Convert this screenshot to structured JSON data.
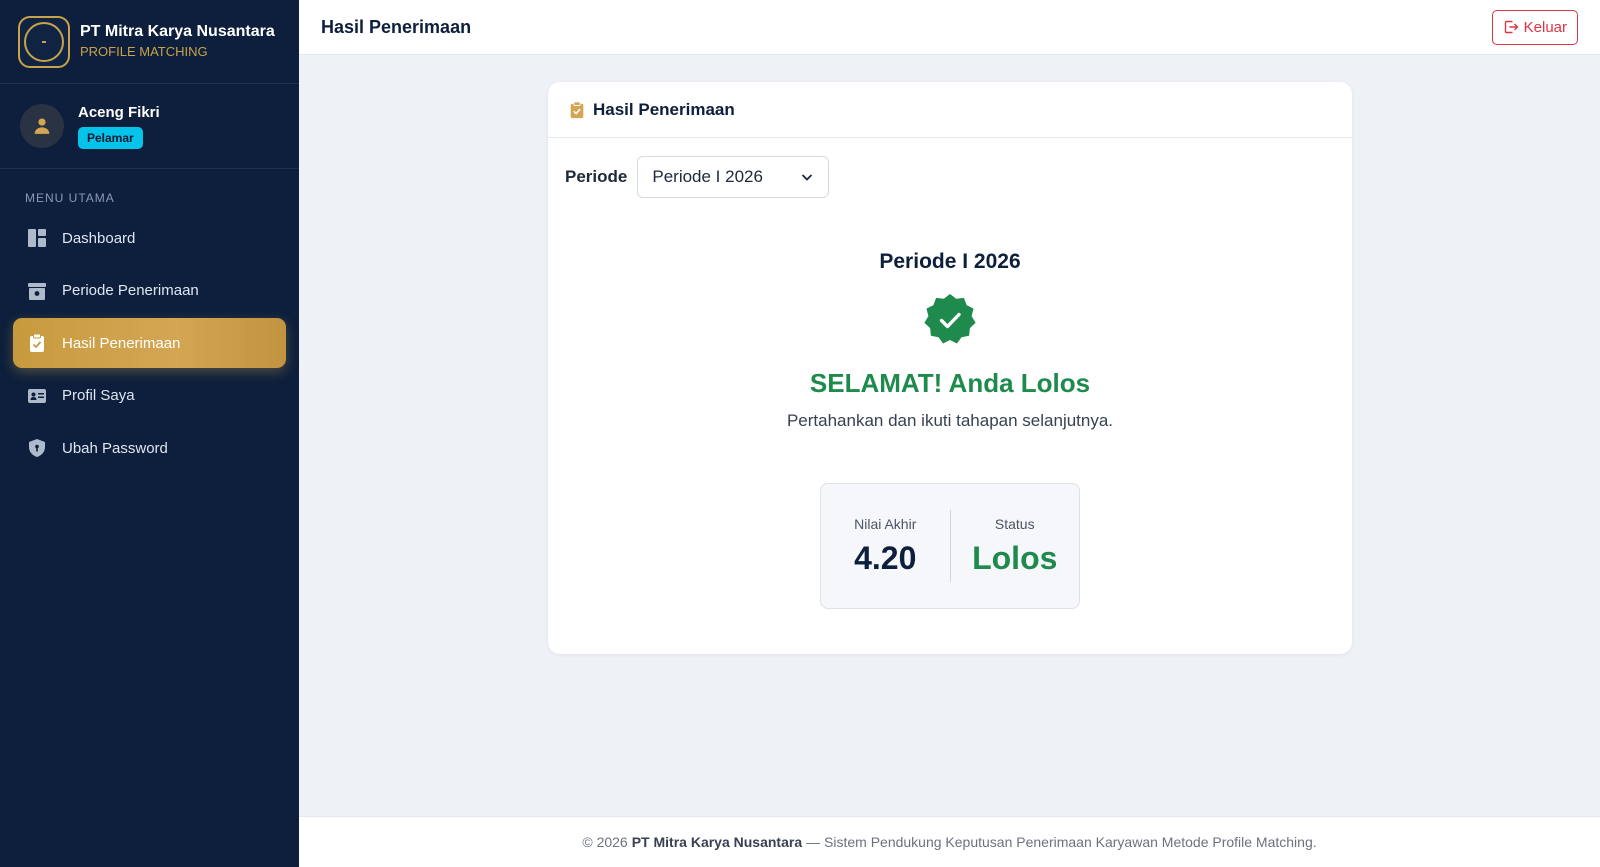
{
  "brand": {
    "name": "PT Mitra Karya Nusantara",
    "subtitle": "PROFILE MATCHING",
    "accent_color": "#c9a24a"
  },
  "user": {
    "name": "Aceng Fikri",
    "role": "Pelamar"
  },
  "sidebar": {
    "section_title": "MENU UTAMA",
    "items": [
      {
        "label": "Dashboard",
        "icon": "dashboard-icon",
        "active": false
      },
      {
        "label": "Periode Penerimaan",
        "icon": "calendar-icon",
        "active": false
      },
      {
        "label": "Hasil Penerimaan",
        "icon": "clipboard-check-icon",
        "active": true
      },
      {
        "label": "Profil Saya",
        "icon": "id-card-icon",
        "active": false
      },
      {
        "label": "Ubah Password",
        "icon": "shield-icon",
        "active": false
      }
    ]
  },
  "header": {
    "title": "Hasil Penerimaan",
    "logout_label": "Keluar"
  },
  "card": {
    "title": "Hasil Penerimaan",
    "period_label": "Periode",
    "period_selected": "Periode I 2026",
    "result": {
      "period": "Periode I 2026",
      "icon": "verified-check-icon",
      "headline": "SELAMAT! Anda Lolos",
      "message": "Pertahankan dan ikuti tahapan selanjutnya.",
      "final_score_label": "Nilai Akhir",
      "final_score": "4.20",
      "status_label": "Status",
      "status": "Lolos",
      "status_color": "#1e8a4c"
    }
  },
  "footer": {
    "prefix": "© 2026",
    "company": "PT Mitra Karya Nusantara",
    "suffix": "— Sistem Pendukung Keputusan Penerimaan Karyawan Metode Profile Matching."
  }
}
